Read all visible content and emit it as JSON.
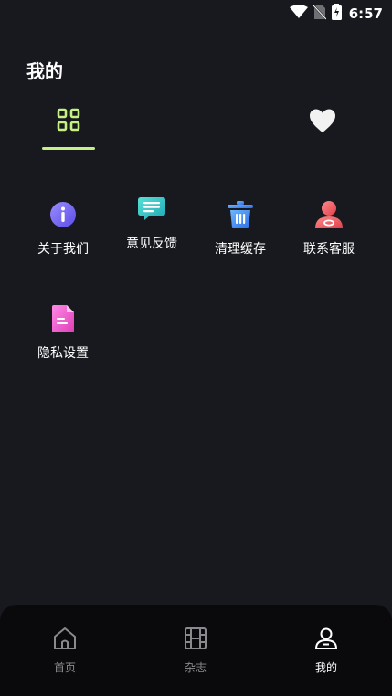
{
  "status_bar": {
    "time": "6:57",
    "icons": [
      "wifi-icon",
      "no-sim-icon",
      "battery-charging-icon"
    ]
  },
  "page": {
    "title": "我的"
  },
  "tabs": [
    {
      "icon": "grid-icon",
      "active": true
    },
    {
      "icon": "heart-icon",
      "active": false
    }
  ],
  "menu": [
    {
      "label": "关于我们",
      "icon": "info-icon",
      "color": "#7b6cf6"
    },
    {
      "label": "意见反馈",
      "icon": "feedback-chat-icon",
      "color": "#2fc5c5"
    },
    {
      "label": "清理缓存",
      "icon": "trash-icon",
      "color": "#3d8ef5"
    },
    {
      "label": "联系客服",
      "icon": "customer-service-icon",
      "color": "#f06262"
    },
    {
      "label": "隐私设置",
      "icon": "document-icon",
      "color": "#f25ed0"
    }
  ],
  "bottom_nav": [
    {
      "label": "首页",
      "icon": "home-icon",
      "active": false
    },
    {
      "label": "杂志",
      "icon": "film-icon",
      "active": false
    },
    {
      "label": "我的",
      "icon": "user-icon",
      "active": true
    }
  ],
  "colors": {
    "accent": "#c6ef86",
    "background": "#18191e",
    "nav_background": "#0a0a0c"
  }
}
